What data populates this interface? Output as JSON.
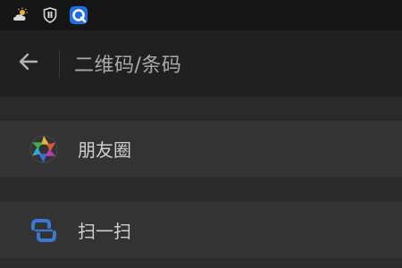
{
  "status_bar": {
    "icons": [
      "weather-cloud-sun-icon",
      "shield-icon",
      "browser-app-icon"
    ]
  },
  "app_bar": {
    "back_icon": "arrow-left-icon",
    "title": "二维码/条码"
  },
  "items": [
    {
      "icon": "moments-aperture-icon",
      "label": "朋友圈"
    },
    {
      "icon": "scan-icon",
      "label": "扫一扫"
    }
  ],
  "colors": {
    "status_bar_bg": "#151515",
    "app_bar_bg": "#202020",
    "item_bg": "#333333",
    "gap_bg": "#2a2a2a"
  }
}
